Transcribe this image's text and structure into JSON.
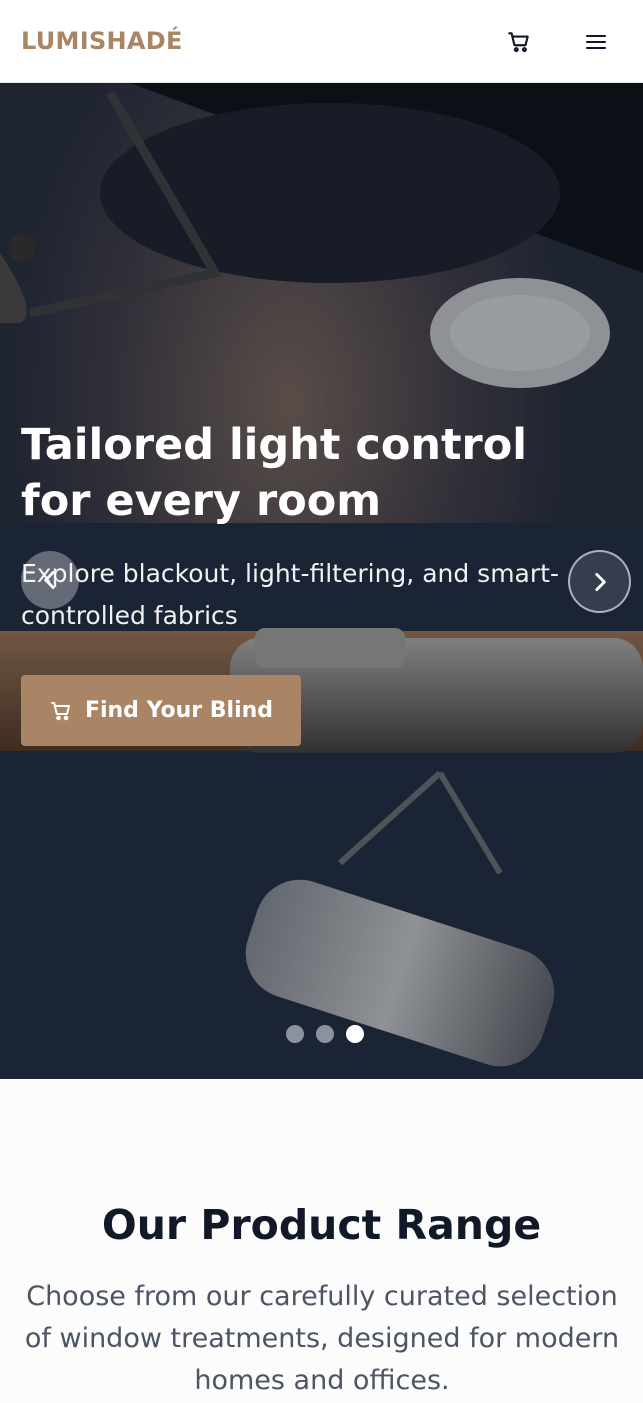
{
  "header": {
    "logo_text": "LUMISHADÉ",
    "cart_icon": "cart-icon",
    "menu_icon": "menu-icon"
  },
  "hero": {
    "title": "Tailored light control for every room",
    "subtitle": "Explore blackout, light-filtering, and smart-controlled fabrics",
    "cta_label": "Find Your Blind",
    "cta_icon": "cart-icon",
    "prev_icon": "chevron-left-icon",
    "next_icon": "chevron-right-icon",
    "slide_count": 3,
    "active_slide": 3
  },
  "products": {
    "title": "Our Product Range",
    "description": "Choose from our carefully curated selection of window treatments, designed for modern homes and offices."
  },
  "colors": {
    "brand": "#a98566",
    "hero_overlay": "#0a0e16",
    "heading": "#111827",
    "body_text": "#4b5563"
  }
}
